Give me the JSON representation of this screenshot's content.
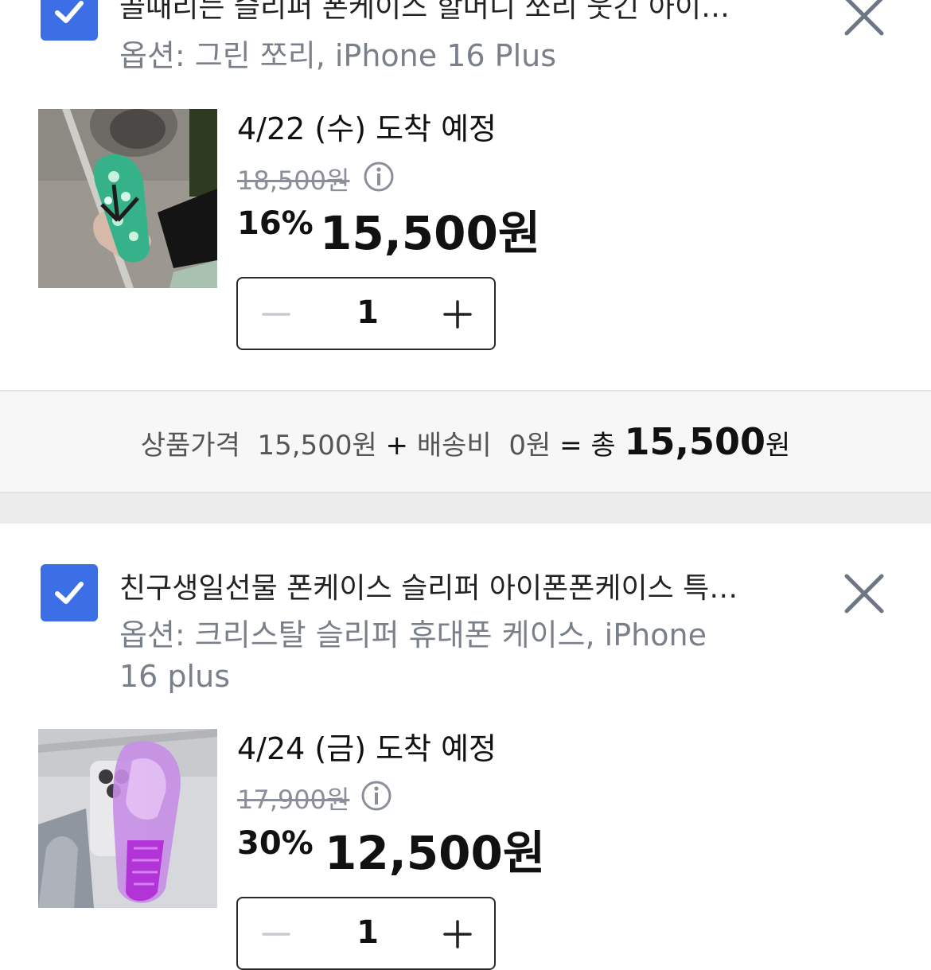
{
  "items": [
    {
      "title": "골때리는 슬리퍼 폰케이스 할머니 쪼리 웃긴 아이…",
      "option_line1": "옵션: 그린 쪼리, iPhone 16 Plus",
      "option_line2": "",
      "arrival": "4/22 (수) 도착 예정",
      "original_price": "18,500원",
      "discount": "16%",
      "sale_price": "15,500원",
      "quantity": "1",
      "checked": true
    },
    {
      "title": "친구생일선물 폰케이스 슬리퍼 아이폰폰케이스 특…",
      "option_line1": "옵션: 크리스탈 슬리퍼 휴대폰 케이스, iPhone",
      "option_line2": "16 plus",
      "arrival": "4/24 (금) 도착 예정",
      "original_price": "17,900원",
      "discount": "30%",
      "sale_price": "12,500원",
      "quantity": "1",
      "checked": true
    }
  ],
  "summary": {
    "product_label": "상품가격",
    "product_price": "15,500원",
    "plus": "+",
    "shipping_label": "배송비",
    "shipping_price": "0원",
    "equals": "=",
    "total_label": "총",
    "total_number": "15,500",
    "total_unit": "원"
  },
  "icons": {
    "check": "check-icon",
    "close": "close-icon",
    "info": "info-icon",
    "minus": "minus-icon",
    "plus": "plus-icon"
  },
  "colors": {
    "accent": "#3c6fe6",
    "option_text": "#7a808a",
    "summary_bg": "#f7f7f7",
    "divider": "#ececec"
  }
}
